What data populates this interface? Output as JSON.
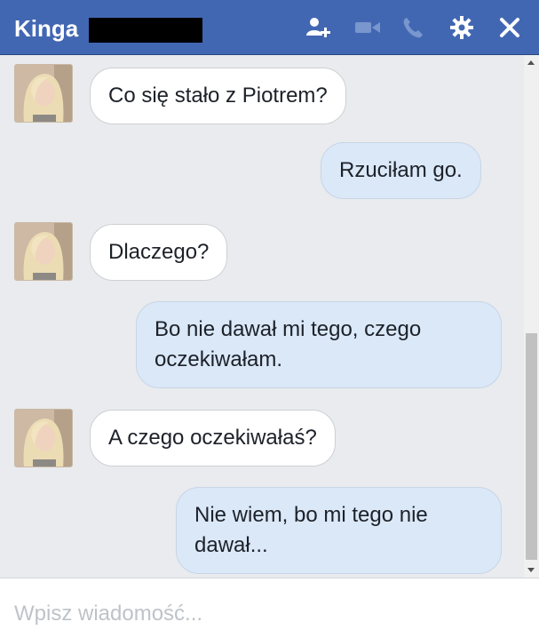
{
  "header": {
    "contact_name": "Kinga",
    "icons": [
      "add-person-icon",
      "video-call-icon",
      "phone-icon",
      "gear-icon",
      "close-icon"
    ]
  },
  "messages": [
    {
      "sender": "contact",
      "text": "Co się stało z Piotrem?"
    },
    {
      "sender": "me",
      "text": "Rzuciłam go."
    },
    {
      "sender": "contact",
      "text": "Dlaczego?"
    },
    {
      "sender": "me",
      "text": "Bo nie dawał mi tego, czego oczekiwałam."
    },
    {
      "sender": "contact",
      "text": "A czego oczekiwałaś?"
    },
    {
      "sender": "me",
      "text": "Nie wiem, bo mi tego nie dawał..."
    }
  ],
  "composer": {
    "placeholder": "Wpisz wiadomość..."
  },
  "colors": {
    "header_bg": "#4267b2",
    "incoming_bubble": "#ffffff",
    "outgoing_bubble": "#dae8f8",
    "chat_bg": "#e9ebee"
  }
}
